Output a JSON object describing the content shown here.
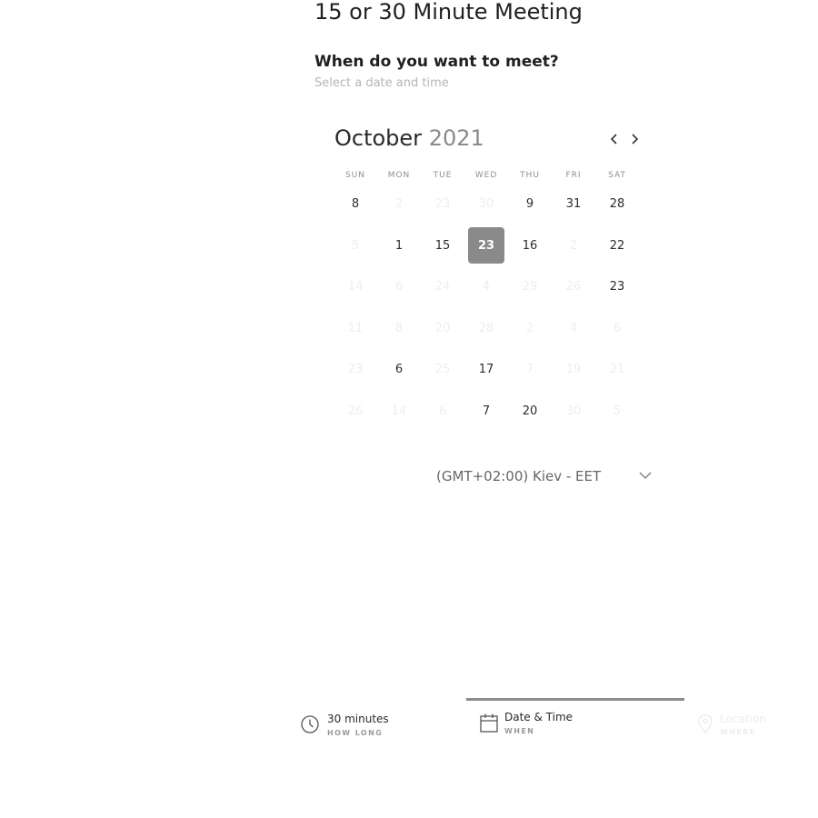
{
  "header": {
    "meeting_title": "15 or 30 Minute Meeting",
    "question": "When do you want to meet?",
    "hint": "Select a date and time"
  },
  "calendar": {
    "month": "October",
    "year": "2021",
    "prev_icon": "chevron-left-icon",
    "next_icon": "chevron-right-icon",
    "weekdays": [
      "SUN",
      "MON",
      "TUE",
      "WED",
      "THU",
      "FRI",
      "SAT"
    ],
    "days": [
      {
        "n": "8",
        "state": "available"
      },
      {
        "n": "2",
        "state": "disabled"
      },
      {
        "n": "23",
        "state": "disabled"
      },
      {
        "n": "30",
        "state": "disabled"
      },
      {
        "n": "9",
        "state": "available"
      },
      {
        "n": "31",
        "state": "available"
      },
      {
        "n": "28",
        "state": "available"
      },
      {
        "n": "5",
        "state": "disabled"
      },
      {
        "n": "1",
        "state": "available"
      },
      {
        "n": "15",
        "state": "available"
      },
      {
        "n": "23",
        "state": "selected"
      },
      {
        "n": "16",
        "state": "available"
      },
      {
        "n": "2",
        "state": "disabled"
      },
      {
        "n": "22",
        "state": "available"
      },
      {
        "n": "14",
        "state": "disabled"
      },
      {
        "n": "6",
        "state": "disabled"
      },
      {
        "n": "24",
        "state": "disabled"
      },
      {
        "n": "4",
        "state": "disabled"
      },
      {
        "n": "29",
        "state": "disabled"
      },
      {
        "n": "26",
        "state": "disabled"
      },
      {
        "n": "23",
        "state": "available"
      },
      {
        "n": "11",
        "state": "disabled"
      },
      {
        "n": "8",
        "state": "disabled"
      },
      {
        "n": "20",
        "state": "disabled"
      },
      {
        "n": "28",
        "state": "disabled"
      },
      {
        "n": "2",
        "state": "disabled"
      },
      {
        "n": "4",
        "state": "disabled"
      },
      {
        "n": "6",
        "state": "disabled"
      },
      {
        "n": "23",
        "state": "disabled"
      },
      {
        "n": "6",
        "state": "available"
      },
      {
        "n": "25",
        "state": "disabled"
      },
      {
        "n": "17",
        "state": "available"
      },
      {
        "n": "7",
        "state": "disabled"
      },
      {
        "n": "19",
        "state": "disabled"
      },
      {
        "n": "21",
        "state": "disabled"
      },
      {
        "n": "26",
        "state": "disabled"
      },
      {
        "n": "14",
        "state": "disabled"
      },
      {
        "n": "6",
        "state": "disabled"
      },
      {
        "n": "7",
        "state": "available"
      },
      {
        "n": "20",
        "state": "available"
      },
      {
        "n": "30",
        "state": "disabled"
      },
      {
        "n": "5",
        "state": "disabled"
      }
    ]
  },
  "timezone": {
    "selected": "(GMT+02:00) Kiev - EET",
    "icon": "chevron-down-icon"
  },
  "steps": [
    {
      "label": "30 minutes",
      "sub": "HOW LONG",
      "icon": "clock-icon",
      "state": "done"
    },
    {
      "label": "Date & Time",
      "sub": "WHEN",
      "icon": "calendar-icon",
      "state": "active"
    },
    {
      "label": "Location",
      "sub": "WHERE",
      "icon": "location-pin-icon",
      "state": "inactive"
    }
  ],
  "colors": {
    "selected_day_bg": "#8a8a8a",
    "active_step_bar": "#8c8c8c",
    "disabled_text": "#eeeeee"
  }
}
